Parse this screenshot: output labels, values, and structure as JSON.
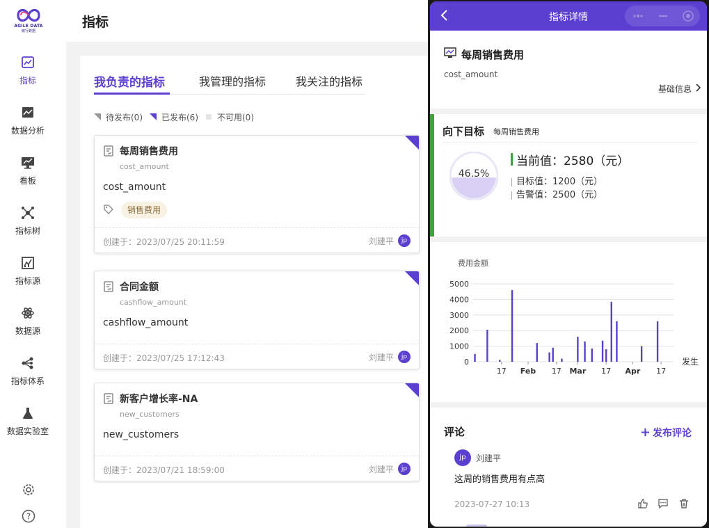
{
  "colors": {
    "accent": "#5b3fd1",
    "success": "#3aa63a",
    "tag_bg": "#f7f2e3"
  },
  "sidebar": {
    "logo_text": "AGILE DATA",
    "logo_sub": "敏行数据",
    "items": [
      {
        "label": "指标",
        "icon": "chart-line-icon",
        "active": true
      },
      {
        "label": "数据分析",
        "icon": "image-chart-icon",
        "active": false
      },
      {
        "label": "看板",
        "icon": "monitor-icon",
        "active": false
      },
      {
        "label": "指标树",
        "icon": "network-icon",
        "active": false
      },
      {
        "label": "指标源",
        "icon": "source-chart-icon",
        "active": false
      },
      {
        "label": "数据源",
        "icon": "atom-icon",
        "active": false
      },
      {
        "label": "指标体系",
        "icon": "share-icon",
        "active": false
      },
      {
        "label": "数据实验室",
        "icon": "flask-icon",
        "active": false
      }
    ],
    "bottom": [
      "settings-icon",
      "help-icon"
    ]
  },
  "header": {
    "title": "指标"
  },
  "tabs": [
    {
      "label": "我负责的指标",
      "active": true
    },
    {
      "label": "我管理的指标",
      "active": false
    },
    {
      "label": "我关注的指标",
      "active": false
    }
  ],
  "filters": [
    {
      "label": "待发布(0)"
    },
    {
      "label": "已发布(6)"
    },
    {
      "label": "不可用(0)"
    }
  ],
  "cards": [
    {
      "name": "每周销售费用",
      "code": "cost_amount",
      "desc": "cost_amount",
      "tag": "销售费用",
      "created": "创建于：2023/07/25 20:11:59",
      "owner": "刘建平",
      "avatar": "jp"
    },
    {
      "name": "合同金额",
      "code": "cashflow_amount",
      "desc": "cashflow_amount",
      "tag": null,
      "created": "创建于：2023/07/25 17:12:43",
      "owner": "刘建平",
      "avatar": "jp"
    },
    {
      "name": "新客户增长率-NA",
      "code": "new_customers",
      "desc": "new_customers",
      "tag": null,
      "created": "创建于：2023/07/21 18:59:00",
      "owner": "刘建平",
      "avatar": "jp"
    }
  ],
  "detail": {
    "title": "指标详情",
    "metric_name": "每周销售费用",
    "metric_code": "cost_amount",
    "basic_info": "基础信息",
    "target_title": "向下目标",
    "target_sub": "每周销售费用",
    "progress_label": "46.5%",
    "progress": 0.465,
    "current": "当前值：2580（元）",
    "target_value": "目标值：1200（元）",
    "warn_value": "告警值：2500（元）",
    "comments_title": "评论",
    "post_comment": "发布评论",
    "comment": {
      "user": "刘建平",
      "avatar": "jp",
      "text": "这周的销售费用有点高",
      "date": "2023-07-27 10:13"
    }
  },
  "chart_data": {
    "type": "bar",
    "ylabel": "费用金额",
    "xlabel": "发生",
    "ylim": [
      0,
      5000
    ],
    "yticks": [
      0,
      1000,
      2000,
      3000,
      4000,
      5000
    ],
    "xticks": [
      "17",
      "Feb",
      "17",
      "Mar",
      "17",
      "Apr",
      "17"
    ],
    "grid": true,
    "series": [
      {
        "values": [
          [
            "2023-01-02",
            500
          ],
          [
            "2023-01-09",
            2050
          ],
          [
            "2023-01-16",
            120
          ],
          [
            "2023-01-23",
            4600
          ],
          [
            "2023-02-06",
            1200
          ],
          [
            "2023-02-13",
            600
          ],
          [
            "2023-02-15",
            900
          ],
          [
            "2023-02-20",
            200
          ],
          [
            "2023-03-01",
            1600
          ],
          [
            "2023-03-05",
            1300
          ],
          [
            "2023-03-09",
            850
          ],
          [
            "2023-03-15",
            1350
          ],
          [
            "2023-03-17",
            800
          ],
          [
            "2023-03-20",
            3850
          ],
          [
            "2023-03-23",
            2600
          ],
          [
            "2023-04-06",
            1000
          ],
          [
            "2023-04-15",
            2600
          ]
        ]
      }
    ]
  }
}
